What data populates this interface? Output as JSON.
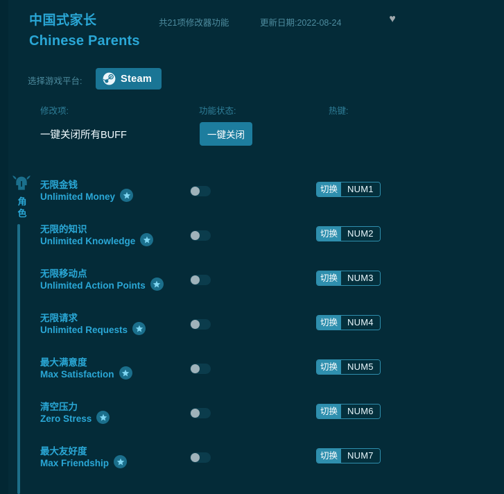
{
  "header": {
    "title_cn": "中国式家长",
    "title_en": "Chinese Parents",
    "feature_count": "共21项修改器功能",
    "update_date": "更新日期:2022-08-24",
    "favorite_icon": "heart-icon",
    "favorite_glyph": "♥"
  },
  "platform": {
    "label": "选择游戏平台:",
    "selected": "Steam",
    "icon": "steam-icon"
  },
  "columns": {
    "item": "修改项:",
    "status": "功能状态:",
    "hotkey": "热键:"
  },
  "close_all": {
    "label": "一键关闭所有BUFF",
    "button": "一键关闭"
  },
  "category": {
    "label": "角色",
    "label_chars": [
      "角",
      "色"
    ],
    "icon": "horned-helmet-icon"
  },
  "colors": {
    "background": "#042b38",
    "gutter": "#022733",
    "accent": "#2aa7d6",
    "button": "#1d7d9e",
    "platform_button": "#1a7595",
    "hotkey_action": "#2f8fae",
    "toggle_track_off": "#0b3c4c",
    "toggle_knob": "#9fb2ba",
    "muted_text": "#4d8b9e",
    "rail_line": "#1d6e89"
  },
  "cheats": [
    {
      "name_cn": "无限金钱",
      "name_en": "Unlimited Money",
      "badge": "star-icon",
      "enabled": false,
      "hotkey_action": "切换",
      "hotkey_key": "NUM1"
    },
    {
      "name_cn": "无限的知识",
      "name_en": "Unlimited Knowledge",
      "badge": "star-icon",
      "enabled": false,
      "hotkey_action": "切换",
      "hotkey_key": "NUM2"
    },
    {
      "name_cn": "无限移动点",
      "name_en": "Unlimited Action Points",
      "badge": "star-icon",
      "enabled": false,
      "hotkey_action": "切换",
      "hotkey_key": "NUM3"
    },
    {
      "name_cn": "无限请求",
      "name_en": "Unlimited Requests",
      "badge": "star-icon",
      "enabled": false,
      "hotkey_action": "切换",
      "hotkey_key": "NUM4"
    },
    {
      "name_cn": "最大满意度",
      "name_en": "Max Satisfaction",
      "badge": "star-icon",
      "enabled": false,
      "hotkey_action": "切换",
      "hotkey_key": "NUM5"
    },
    {
      "name_cn": "清空压力",
      "name_en": "Zero Stress",
      "badge": "star-icon",
      "enabled": false,
      "hotkey_action": "切换",
      "hotkey_key": "NUM6"
    },
    {
      "name_cn": "最大友好度",
      "name_en": "Max Friendship",
      "badge": "star-icon",
      "enabled": false,
      "hotkey_action": "切换",
      "hotkey_key": "NUM7"
    }
  ]
}
